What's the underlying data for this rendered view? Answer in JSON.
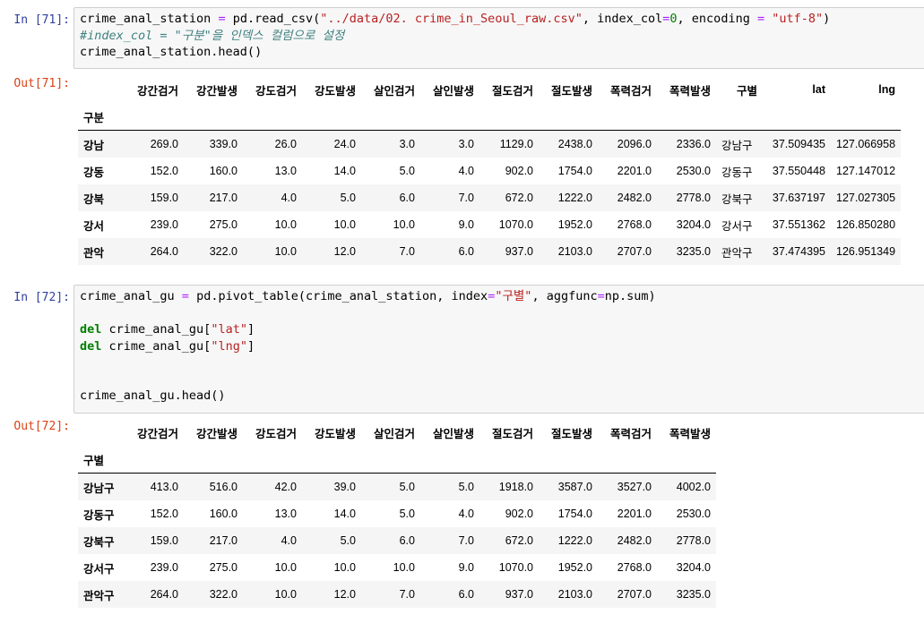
{
  "cell71": {
    "in_prompt": "In [71]:",
    "out_prompt": "Out[71]:",
    "code": [
      [
        [
          "t",
          "crime_anal_station "
        ],
        [
          "op",
          "="
        ],
        [
          "t",
          " pd.read_csv("
        ],
        [
          "str",
          "\"../data/02. crime_in_Seoul_raw.csv\""
        ],
        [
          "t",
          ", index_col"
        ],
        [
          "op",
          "="
        ],
        [
          "num",
          "0"
        ],
        [
          "t",
          ", encoding "
        ],
        [
          "op",
          "="
        ],
        [
          "t",
          " "
        ],
        [
          "str",
          "\"utf-8\""
        ],
        [
          "t",
          ")"
        ]
      ],
      [
        [
          "cmt",
          "#index_col = \"구분\"을 인덱스 컬럼으로 설정"
        ]
      ],
      [
        [
          "t",
          "crime_anal_station.head()"
        ]
      ]
    ],
    "table": {
      "index_name": "구분",
      "columns": [
        "강간검거",
        "강간발생",
        "강도검거",
        "강도발생",
        "살인검거",
        "살인발생",
        "절도검거",
        "절도발생",
        "폭력검거",
        "폭력발생",
        "구별",
        "lat",
        "lng"
      ],
      "rows": [
        {
          "index": "강남",
          "values": [
            "269.0",
            "339.0",
            "26.0",
            "24.0",
            "3.0",
            "3.0",
            "1129.0",
            "2438.0",
            "2096.0",
            "2336.0",
            "강남구",
            "37.509435",
            "127.066958"
          ]
        },
        {
          "index": "강동",
          "values": [
            "152.0",
            "160.0",
            "13.0",
            "14.0",
            "5.0",
            "4.0",
            "902.0",
            "1754.0",
            "2201.0",
            "2530.0",
            "강동구",
            "37.550448",
            "127.147012"
          ]
        },
        {
          "index": "강북",
          "values": [
            "159.0",
            "217.0",
            "4.0",
            "5.0",
            "6.0",
            "7.0",
            "672.0",
            "1222.0",
            "2482.0",
            "2778.0",
            "강북구",
            "37.637197",
            "127.027305"
          ]
        },
        {
          "index": "강서",
          "values": [
            "239.0",
            "275.0",
            "10.0",
            "10.0",
            "10.0",
            "9.0",
            "1070.0",
            "1952.0",
            "2768.0",
            "3204.0",
            "강서구",
            "37.551362",
            "126.850280"
          ]
        },
        {
          "index": "관악",
          "values": [
            "264.0",
            "322.0",
            "10.0",
            "12.0",
            "7.0",
            "6.0",
            "937.0",
            "2103.0",
            "2707.0",
            "3235.0",
            "관악구",
            "37.474395",
            "126.951349"
          ]
        }
      ]
    }
  },
  "cell72": {
    "in_prompt": "In [72]:",
    "out_prompt": "Out[72]:",
    "code": [
      [
        [
          "t",
          "crime_anal_gu "
        ],
        [
          "op",
          "="
        ],
        [
          "t",
          " pd.pivot_table(crime_anal_station, index"
        ],
        [
          "op",
          "="
        ],
        [
          "str",
          "\"구별\""
        ],
        [
          "t",
          ", aggfunc"
        ],
        [
          "op",
          "="
        ],
        [
          "t",
          "np.sum)"
        ]
      ],
      [],
      [
        [
          "kw",
          "del"
        ],
        [
          "t",
          " crime_anal_gu["
        ],
        [
          "str",
          "\"lat\""
        ],
        [
          "t",
          "]"
        ]
      ],
      [
        [
          "kw",
          "del"
        ],
        [
          "t",
          " crime_anal_gu["
        ],
        [
          "str",
          "\"lng\""
        ],
        [
          "t",
          "]"
        ]
      ],
      [],
      [],
      [
        [
          "t",
          "crime_anal_gu.head()"
        ]
      ]
    ],
    "table": {
      "index_name": "구별",
      "columns": [
        "강간검거",
        "강간발생",
        "강도검거",
        "강도발생",
        "살인검거",
        "살인발생",
        "절도검거",
        "절도발생",
        "폭력검거",
        "폭력발생"
      ],
      "rows": [
        {
          "index": "강남구",
          "values": [
            "413.0",
            "516.0",
            "42.0",
            "39.0",
            "5.0",
            "5.0",
            "1918.0",
            "3587.0",
            "3527.0",
            "4002.0"
          ]
        },
        {
          "index": "강동구",
          "values": [
            "152.0",
            "160.0",
            "13.0",
            "14.0",
            "5.0",
            "4.0",
            "902.0",
            "1754.0",
            "2201.0",
            "2530.0"
          ]
        },
        {
          "index": "강북구",
          "values": [
            "159.0",
            "217.0",
            "4.0",
            "5.0",
            "6.0",
            "7.0",
            "672.0",
            "1222.0",
            "2482.0",
            "2778.0"
          ]
        },
        {
          "index": "강서구",
          "values": [
            "239.0",
            "275.0",
            "10.0",
            "10.0",
            "10.0",
            "9.0",
            "1070.0",
            "1952.0",
            "2768.0",
            "3204.0"
          ]
        },
        {
          "index": "관악구",
          "values": [
            "264.0",
            "322.0",
            "10.0",
            "12.0",
            "7.0",
            "6.0",
            "937.0",
            "2103.0",
            "2707.0",
            "3235.0"
          ]
        }
      ]
    }
  }
}
